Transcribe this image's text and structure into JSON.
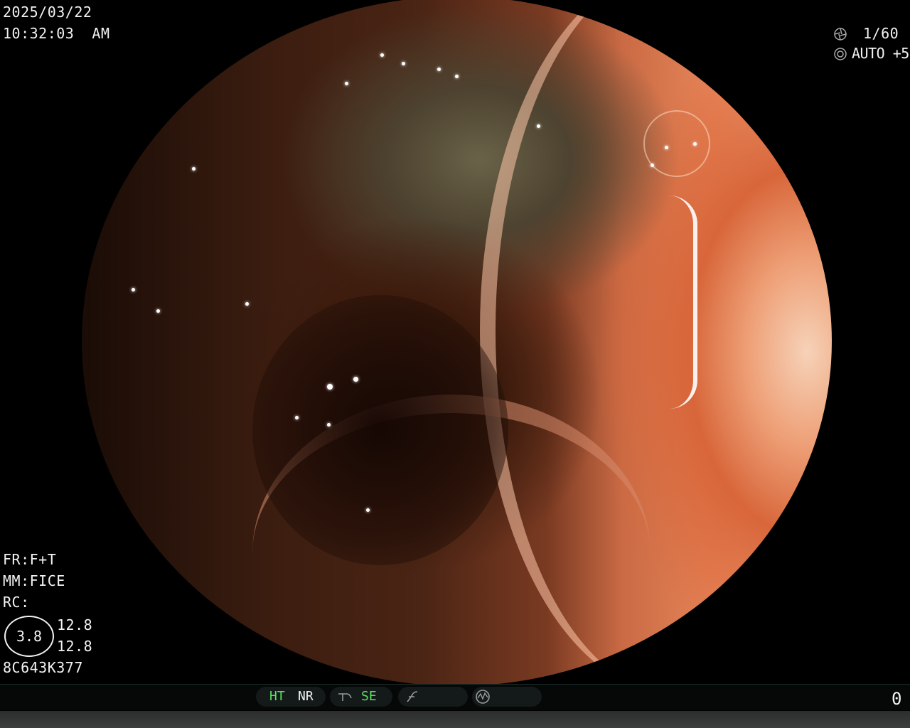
{
  "datetime": {
    "date": "2025/03/22",
    "time": "10:32:03  AM"
  },
  "exposure": {
    "shutter_icon": "aperture-icon",
    "shutter": "1/60",
    "iris_icon": "iris-icon",
    "iris": "AUTO +5"
  },
  "settings": {
    "fr": "FR:F+T",
    "mm": "MM:FICE",
    "rc": "RC:",
    "ihb_value": "3.8",
    "value1": "12.8",
    "value2": "12.8",
    "scope_id": "8C643K377"
  },
  "status_bar": {
    "ht": "HT",
    "nr": "NR",
    "sharpness_icon": "sharpness-icon",
    "se": "SE",
    "curve_icon": "curve-icon",
    "signal_icon": "signal-icon",
    "counter": "0"
  },
  "colors": {
    "active": "#59e25f",
    "text": "#f2f2f2"
  }
}
